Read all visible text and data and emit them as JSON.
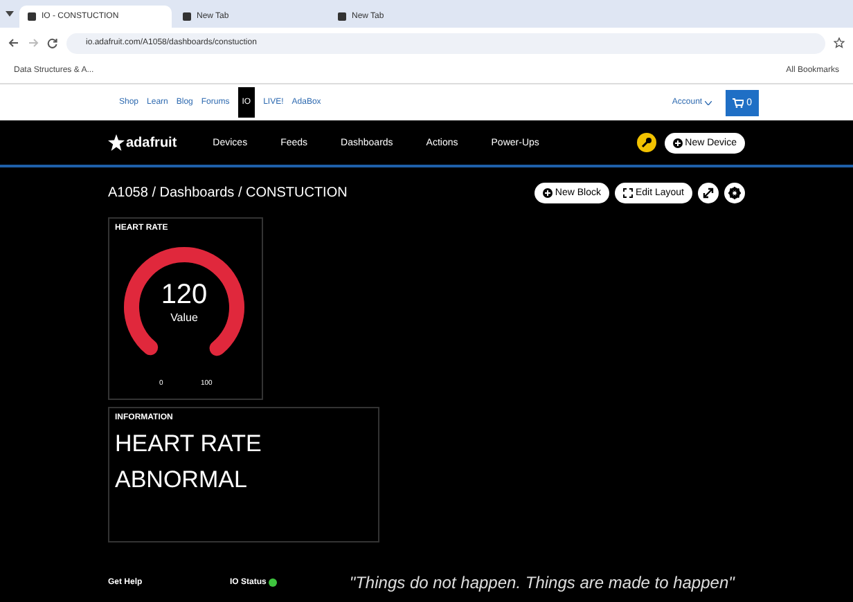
{
  "browser": {
    "tabs": [
      {
        "title": "IO - CONSTUCTION",
        "selected": true
      },
      {
        "title": "New Tab",
        "selected": false
      },
      {
        "title": "New Tab",
        "selected": false
      }
    ],
    "url": "io.adafruit.com/A1058/dashboards/constuction",
    "bookmarks": [
      "Data Structures & A..."
    ],
    "all_bookmarks": "All Bookmarks"
  },
  "topnav": {
    "links": [
      {
        "label": "Shop",
        "selected": false
      },
      {
        "label": "Learn",
        "selected": false
      },
      {
        "label": "Blog",
        "selected": false
      },
      {
        "label": "Forums",
        "selected": false
      },
      {
        "label": "IO",
        "selected": true
      },
      {
        "label": "LIVE!",
        "selected": false
      },
      {
        "label": "AdaBox",
        "selected": false
      }
    ],
    "account": "Account",
    "cart_count": "0"
  },
  "header": {
    "brand": "adafruit",
    "menu": [
      "Devices",
      "Feeds",
      "Dashboards",
      "Actions",
      "Power-Ups"
    ],
    "new_device": "New Device"
  },
  "breadcrumb": "A1058 / Dashboards / CONSTUCTION",
  "actions": {
    "new_block": "New Block",
    "edit_layout": "Edit Layout"
  },
  "blocks": [
    {
      "kind": "gauge",
      "title": "HEART RATE",
      "value": "120",
      "caption": "Value",
      "min": "0",
      "max": "100",
      "level": 1
    },
    {
      "kind": "text",
      "title": "INFORMATION",
      "lines": [
        "HEART RATE",
        "ABNORMAL"
      ]
    }
  ],
  "footer": {
    "help": "Get Help",
    "status": "IO Status",
    "status_ok": true,
    "quote": "\"Things do not happen. Things are made to happen\""
  }
}
